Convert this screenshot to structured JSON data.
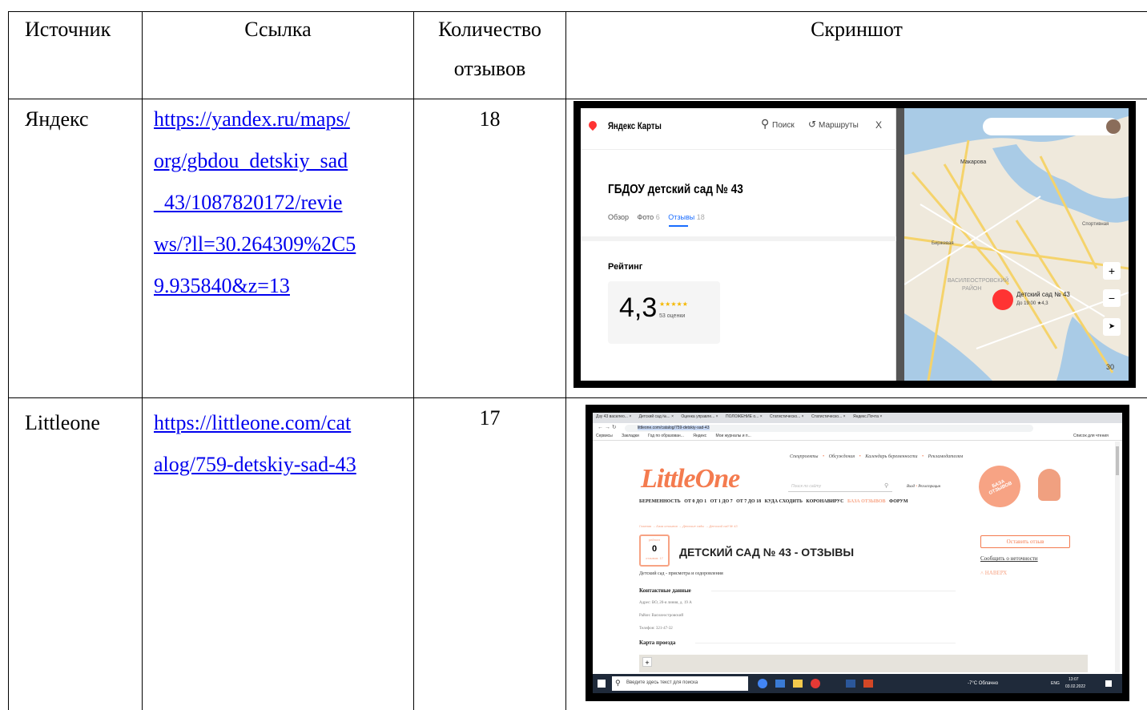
{
  "table": {
    "headers": [
      "Источник",
      "Ссылка",
      "Количество",
      "отзывов",
      "Скриншот"
    ],
    "rows": [
      {
        "source": "Яндекс",
        "link_lines": [
          "https://yandex.ru/maps/",
          "org/gbdou_detskiy_sad",
          "_43/1087820172/revie",
          "ws/?ll=30.264309%2C5",
          "9.935840&z=13"
        ],
        "count": "18"
      },
      {
        "source": "Littleone",
        "link_lines": [
          "https://littleone.com/cat",
          "alog/759-detskiy-sad-43"
        ],
        "count": "17"
      }
    ]
  },
  "yandex_shot": {
    "app_title": "Яндекс Карты",
    "search_label": "Поиск",
    "routes_label": "Маршруты",
    "close_label": "X",
    "org_title": "ГБДОУ детский сад № 43",
    "tabs": [
      "Обзор",
      "Фото",
      "Отзывы"
    ],
    "tab_counts": [
      "6",
      "18"
    ],
    "rating_label": "Рейтинг",
    "rating_value": "4,3",
    "rating_stars": "★★★★★",
    "rating_count": "53 оценки",
    "map_marker_title": "Детский сад № 43",
    "map_marker_sub": "До 19:00 ★4,3",
    "map_labels": [
      "Макарова",
      "ВАСИЛЕОСТРОВСКИЙ",
      "РАЙОН",
      "Биржевая",
      "Спортивная"
    ],
    "zoom_in": "+",
    "zoom_out": "−",
    "zoom_level": "30",
    "accent": "#ff3333"
  },
  "littleone_shot": {
    "tabs": [
      "Дзу 43 василео...",
      "Детский сад №...",
      "Оценка управле...",
      "ПОЛОЖЕНИЕ о...",
      "Статистическо...",
      "Статистическо...",
      "Яндекс.Почта"
    ],
    "url": "littleone.com/catalog/759-detskiy-sad-43",
    "bookmarks": [
      "Сервисы",
      "Закладки",
      "Год по образован...",
      "Яндекс",
      "Мои журналы и п..."
    ],
    "bookmarks_right": "Список для чтения",
    "top_links": [
      "Спецпроекты",
      "Обсуждения",
      "Календарь беременности",
      "Рекламодателям"
    ],
    "logo": "LittleOne",
    "search_placeholder": "Поиск по сайту",
    "login": "Вход",
    "register": "Регистрация",
    "badge": "БАЗА ОТЗЫВОВ",
    "nav": [
      "БЕРЕМЕННОСТЬ",
      "ОТ 0 ДО 1",
      "ОТ 1 ДО 7",
      "ОТ 7 ДО 18",
      "КУДА СХОДИТЬ",
      "КОРОНАВИРУС",
      "БАЗА ОТЗЫВОВ",
      "ФОРУМ"
    ],
    "breadcrumb": "Главная → База отзывов → Детские сады → Детский сад № 43",
    "rating_caption": "рейтинг",
    "rating_value": "0",
    "reviews_caption": "отзывов: 17",
    "title": "ДЕТСКИЙ САД № 43 - ОТЗЫВЫ",
    "leave_review": "Оставить отзыв",
    "report_error": "Сообщить о неточности",
    "to_top": "НАВЕРХ",
    "subtitle": "Детский сад - присмотра и оздоровления",
    "contacts_heading": "Контактные данные",
    "address": "Адрес: ВО, 20-я линия, д. 19 А",
    "district": "Район: Василеостровский",
    "phone": "Телефон: 321-47-32",
    "map_heading": "Карта проезда",
    "taskbar_search": "Введите здесь текст для поиска",
    "weather": "-7°С Облачно",
    "lang": "ENG",
    "time": "13:07",
    "date": "03.02.2022",
    "accent": "#f47b4f"
  }
}
